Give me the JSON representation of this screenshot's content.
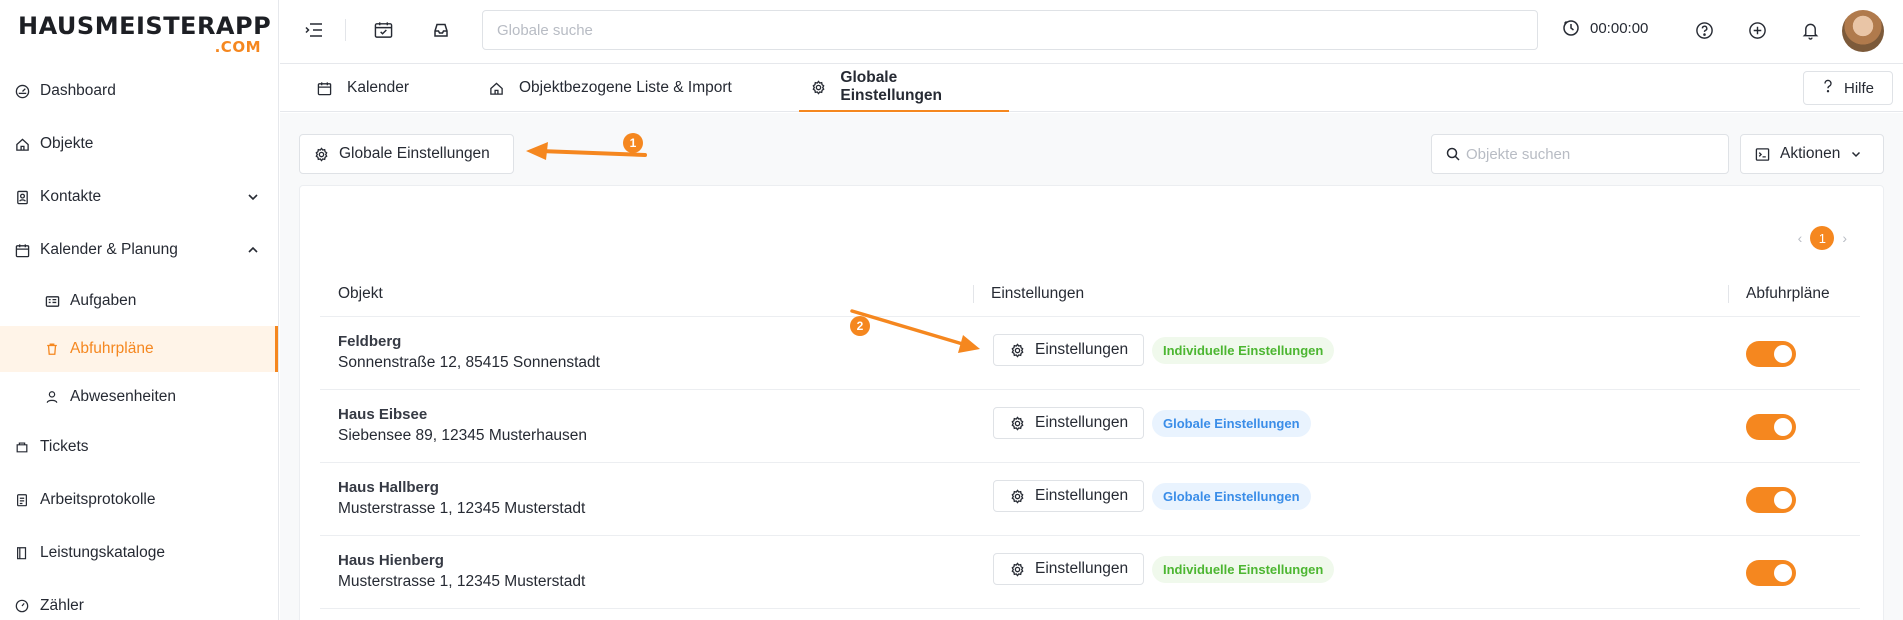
{
  "app": {
    "logo_main": "HAUSMEISTERAPP",
    "logo_sub": ".COM",
    "accent_color": "#f5871f"
  },
  "sidebar": {
    "items": [
      {
        "label": "Dashboard",
        "icon": "dashboard-icon"
      },
      {
        "label": "Objekte",
        "icon": "home-icon"
      },
      {
        "label": "Kontakte",
        "icon": "contacts-icon",
        "expand": "collapsed"
      },
      {
        "label": "Kalender & Planung",
        "icon": "calendar-icon",
        "expand": "expanded"
      },
      {
        "label": "Aufgaben",
        "icon": "tasks-icon",
        "sub": true
      },
      {
        "label": "Abfuhrpläne",
        "icon": "trash-icon",
        "sub": true,
        "active": true
      },
      {
        "label": "Abwesenheiten",
        "icon": "user-icon",
        "sub": true
      },
      {
        "label": "Tickets",
        "icon": "ticket-icon"
      },
      {
        "label": "Arbeitsprotokolle",
        "icon": "clipboard-icon"
      },
      {
        "label": "Leistungskataloge",
        "icon": "book-icon"
      },
      {
        "label": "Zähler",
        "icon": "gauge-icon"
      }
    ]
  },
  "topbar": {
    "search_placeholder": "Globale suche",
    "timer": "00:00:00"
  },
  "tabs": {
    "items": [
      {
        "label": "Kalender",
        "icon": "calendar-icon"
      },
      {
        "label": "Objektbezogene Liste & Import",
        "icon": "home-icon"
      },
      {
        "label": "Globale Einstellungen",
        "icon": "gear-icon",
        "active": true
      }
    ],
    "help_label": "Hilfe"
  },
  "toolbar": {
    "global_settings_label": "Globale Einstellungen",
    "object_search_placeholder": "Objekte suchen",
    "actions_label": "Aktionen"
  },
  "pagination": {
    "current_page": "1"
  },
  "table": {
    "columns": [
      "Objekt",
      "Einstellungen",
      "Abfuhrpläne"
    ],
    "settings_button_label": "Einstellungen",
    "rows": [
      {
        "name": "Feldberg",
        "address": "Sonnenstraße 12, 85415 Sonnenstadt",
        "badge": "Individuelle Einstellungen",
        "badge_type": "individual",
        "enabled": true
      },
      {
        "name": "Haus Eibsee",
        "address": "Siebensee 89, 12345 Musterhausen",
        "badge": "Globale Einstellungen",
        "badge_type": "global",
        "enabled": true
      },
      {
        "name": "Haus Hallberg",
        "address": "Musterstrasse 1, 12345 Musterstadt",
        "badge": "Globale Einstellungen",
        "badge_type": "global",
        "enabled": true
      },
      {
        "name": "Haus Hienberg",
        "address": "Musterstrasse 1, 12345 Musterstadt",
        "badge": "Individuelle Einstellungen",
        "badge_type": "individual",
        "enabled": true
      }
    ]
  },
  "annotations": {
    "marker_1": "1",
    "marker_2": "2"
  }
}
